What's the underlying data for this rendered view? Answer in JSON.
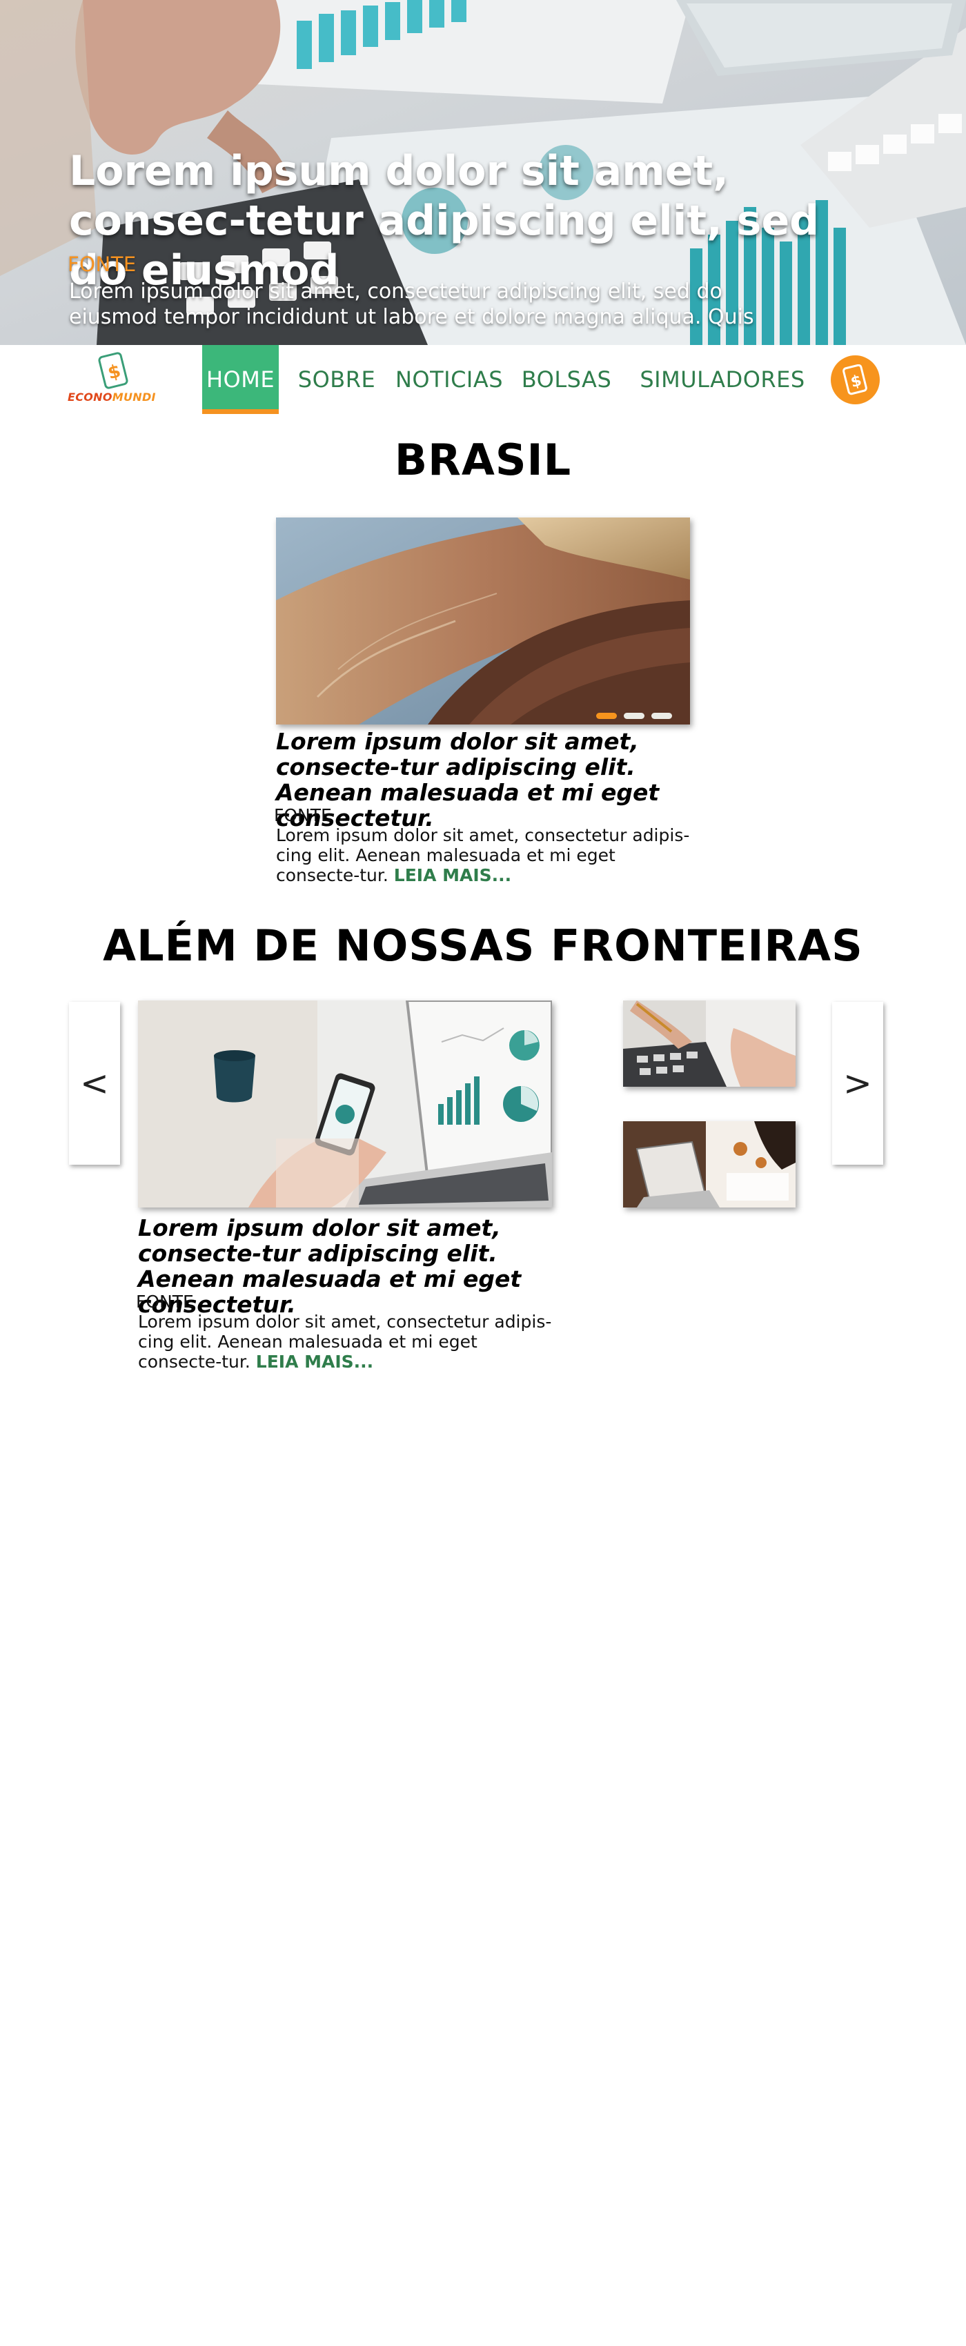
{
  "hero": {
    "title": "Lorem ipsum dolor sit amet, consec-tetur adipiscing elit, sed do eiusmod",
    "source": "FONTE",
    "text": "Lorem ipsum dolor sit amet, consectetur adipiscing elit, sed do eiusmod tempor incididunt ut labore et dolore magna aliqua. Quis"
  },
  "nav": {
    "logo_part1": "ECONO",
    "logo_part2": "MUNDI",
    "items": [
      {
        "label": "HOME",
        "active": true
      },
      {
        "label": "SOBRE",
        "active": false
      },
      {
        "label": "NOTICIAS",
        "active": false
      },
      {
        "label": "BOLSAS",
        "active": false
      },
      {
        "label": "SIMULADORES",
        "active": false
      }
    ],
    "coin_icon": "dollar-coin-icon"
  },
  "brasil": {
    "heading": "BRASIL",
    "article": {
      "title": "Lorem ipsum dolor sit amet, consecte-tur adipiscing elit. Aenean malesuada et mi eget consectetur.",
      "source": "FONTE",
      "text": "Lorem ipsum dolor sit amet, consectetur adipis-cing elit. Aenean malesuada et mi eget consecte-tur.",
      "read_more": "LEIA MAIS..."
    },
    "carousel": {
      "slides": 3,
      "active_index": 0
    }
  },
  "alem": {
    "heading": "ALÉM DE NOSSAS FRONTEIRAS",
    "prev": "<",
    "next": ">",
    "article": {
      "title": "Lorem ipsum dolor sit amet, consecte-tur adipiscing elit. Aenean malesuada et mi eget consectetur.",
      "source": "FONTE",
      "text": "Lorem ipsum dolor sit amet, consectetur adipis-cing elit. Aenean malesuada et mi eget consecte-tur.",
      "read_more": "LEIA MAIS..."
    }
  },
  "colors": {
    "brand_green": "#2f7d4b",
    "active_green": "#3cb77a",
    "brand_orange": "#f7941d"
  }
}
